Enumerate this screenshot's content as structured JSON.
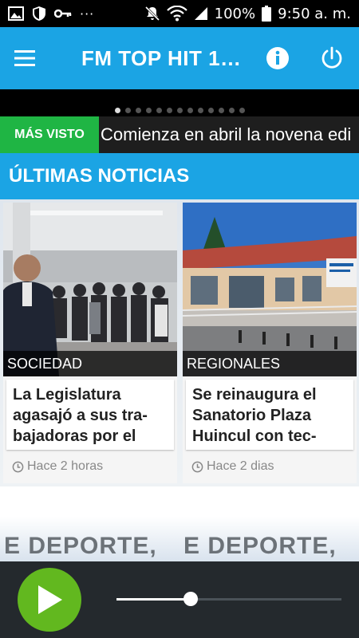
{
  "status_bar": {
    "left_icons": [
      "image-icon",
      "shield-icon",
      "key-icon"
    ],
    "overflow": "···",
    "battery_percent": "100%",
    "time": "9:50 a. m."
  },
  "app_bar": {
    "title": "FM TOP HIT 1…",
    "menu_icon": "menu-icon",
    "info_icon": "info-icon",
    "power_icon": "power-icon"
  },
  "carousel": {
    "total_slides": 13,
    "active_index": 0
  },
  "ticker": {
    "badge": "MÁS VISTO",
    "text": "Comienza en abril la novena edi"
  },
  "section": {
    "title": "ÚLTIMAS NOTICIAS"
  },
  "cards": [
    {
      "category": "SOCIEDAD",
      "title": "La Legislatura agasajó a sus tra-bajadoras por el",
      "time": "Hace 2 horas"
    },
    {
      "category": "REGIONALES",
      "title": "Se reinaugura el Sanatorio Plaza Huincul con tec-",
      "time": "Hace 2 dias"
    }
  ],
  "banner": {
    "left": "E DEPORTE,",
    "right": "E DEPORTE,"
  },
  "player": {
    "volume_level": 0.33,
    "colors": {
      "play": "#62b81f",
      "bar": "#24292d"
    }
  },
  "colors": {
    "primary": "#1ba4e4",
    "badge": "#1fb544",
    "ticker_bg": "#1e1e1e"
  }
}
